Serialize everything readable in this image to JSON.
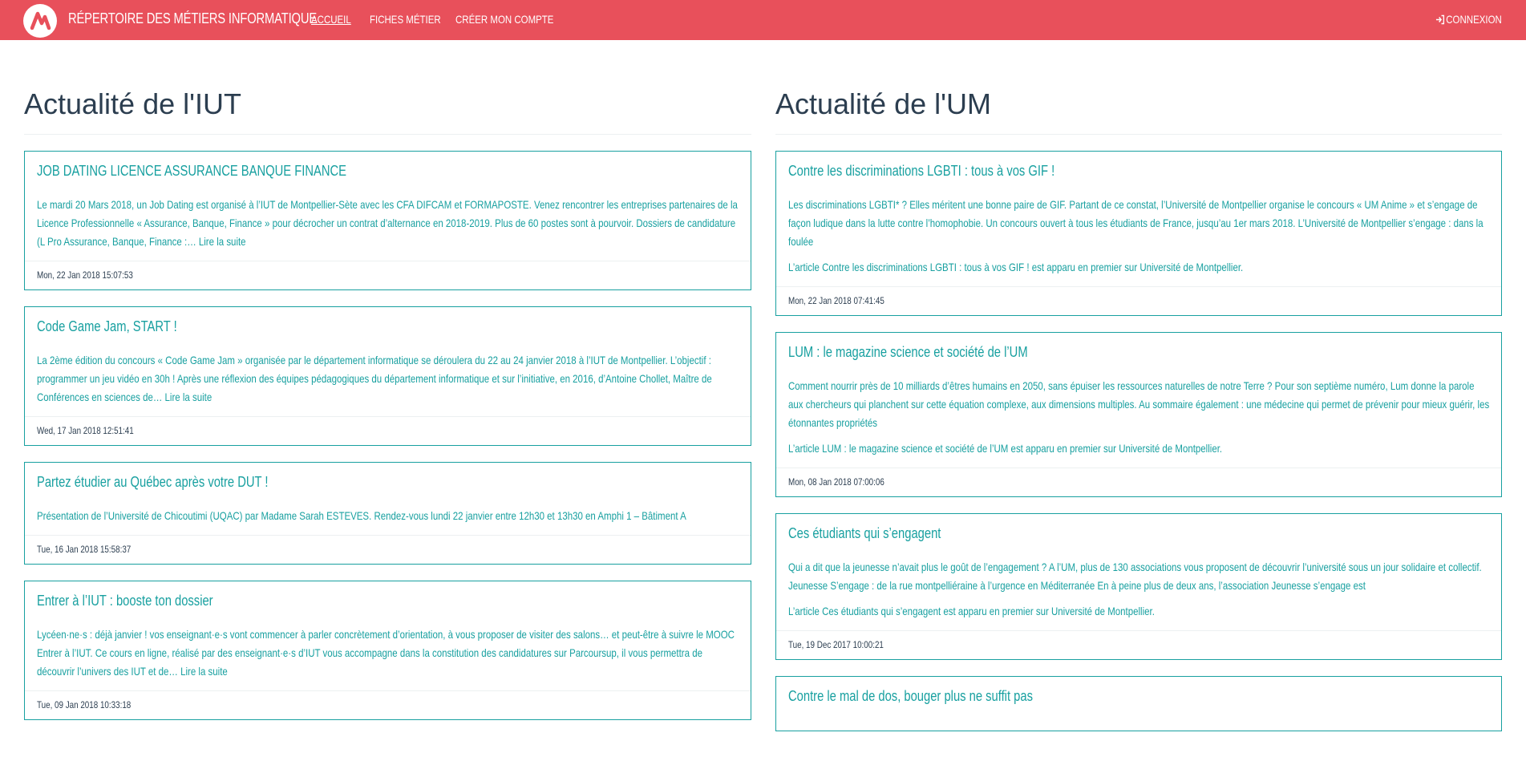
{
  "nav": {
    "brand": "RÉPERTOIRE DES MÉTIERS INFORMATIQUE",
    "links": [
      "ACCUEIL",
      "FICHES MÉTIER",
      "CRÉER MON COMPTE"
    ],
    "login": "CONNEXION",
    "logo_icon": "brand-logo-icon",
    "login_icon": "sign-in-icon"
  },
  "colors": {
    "navbar": "#e8505b",
    "accent": "#18a0a0",
    "heading": "#2c3e50"
  },
  "left": {
    "title": "Actualité de l'IUT",
    "items": [
      {
        "title": "JOB DATING LICENCE ASSURANCE BANQUE FINANCE",
        "text": "Le mardi 20 Mars 2018, un Job Dating est organisé à l’IUT de Montpellier-Sète avec les CFA DIFCAM et FORMAPOSTE. Venez rencontrer les entreprises partenaires de la Licence Professionnelle « Assurance, Banque, Finance » pour décrocher un contrat d’alternance en 2018-2019. Plus de 60 postes sont à pourvoir. Dossiers de candidature (L Pro Assurance, Banque, Finance :… Lire la suite",
        "date": "Mon, 22 Jan 2018 15:07:53"
      },
      {
        "title": "Code Game Jam, START !",
        "text": "La 2ème édition du concours « Code Game Jam » organisée par le département informatique se déroulera du 22 au 24 janvier 2018 à l’IUT de Montpellier. L’objectif : programmer un jeu vidéo en 30h ! Après une réflexion des équipes pédagogiques du département informatique et sur l’initiative, en 2016, d’Antoine Chollet, Maître de Conférences en sciences de… Lire la suite",
        "date": "Wed, 17 Jan 2018 12:51:41"
      },
      {
        "title": "Partez étudier au Québec après votre DUT !",
        "text": "Présentation de l’Université de Chicoutimi (UQAC) par Madame Sarah ESTEVES. Rendez-vous lundi 22 janvier entre 12h30 et 13h30 en Amphi 1 – Bâtiment A",
        "date": "Tue, 16 Jan 2018 15:58:37"
      },
      {
        "title": "Entrer à l’IUT : booste ton dossier",
        "text": "Lycéen·ne·s : déjà janvier ! vos enseignant·e·s vont commencer à parler concrètement d’orientation, à vous proposer de visiter des salons… et peut-être à suivre le MOOC Entrer à l’IUT. Ce cours en ligne, réalisé par des enseignant·e·s d’IUT vous accompagne dans la constitution des candidatures sur Parcoursup, il vous permettra de découvrir l’univers des IUT et de… Lire la suite",
        "date": "Tue, 09 Jan 2018 10:33:18"
      }
    ]
  },
  "right": {
    "title": "Actualité de l'UM",
    "items": [
      {
        "title": "Contre les discriminations LGBTI : tous à vos GIF !",
        "text": "Les discriminations LGBTI* ? Elles méritent une bonne paire de GIF. Partant de ce constat, l’Université de Montpellier organise le concours « UM Anime » et s’engage de façon ludique dans la lutte contre l’homophobie. Un concours ouvert à tous les étudiants de France, jusqu’au 1er mars 2018. L’Université de Montpellier s’engage : dans la foulée",
        "extra": "L’article Contre les discriminations LGBTI : tous à vos GIF ! est apparu en premier sur Université de Montpellier.",
        "date": "Mon, 22 Jan 2018 07:41:45"
      },
      {
        "title": "LUM : le magazine science et société de l’UM",
        "text": "Comment nourrir près de 10 milliards d’êtres humains en 2050, sans épuiser les ressources naturelles de notre Terre ? Pour son septième numéro, Lum donne la parole aux chercheurs qui planchent sur cette équation complexe, aux dimensions multiples. Au sommaire également : une médecine qui permet de prévenir pour mieux guérir, les étonnantes propriétés",
        "extra": "L’article LUM : le magazine science et société de l’UM est apparu en premier sur Université de Montpellier.",
        "date": "Mon, 08 Jan 2018 07:00:06"
      },
      {
        "title": "Ces étudiants qui s’engagent",
        "text": "Qui a dit que la jeunesse n’avait plus le goût de l’engagement ? A l’UM, plus de 130 associations vous proposent de découvrir l’université sous un jour solidaire et collectif. Jeunesse S’engage : de la rue montpelliéraine à l’urgence en Méditerranée En à peine plus de deux ans, l’association Jeunesse s’engage est",
        "extra": "L’article Ces étudiants qui s’engagent est apparu en premier sur Université de Montpellier.",
        "date": "Tue, 19 Dec 2017 10:00:21"
      },
      {
        "title": "Contre le mal de dos, bouger plus ne suffit pas",
        "text": "",
        "extra": "",
        "date": ""
      }
    ]
  }
}
